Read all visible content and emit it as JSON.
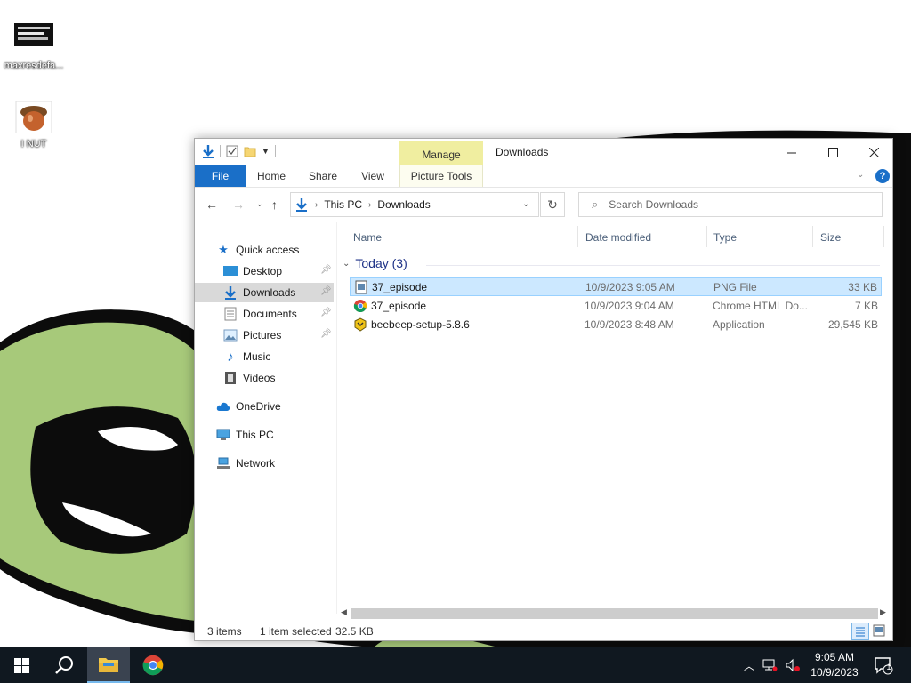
{
  "desktop": {
    "icons": [
      {
        "label": "maxresdefa..."
      },
      {
        "label": "I NUT"
      }
    ]
  },
  "window": {
    "title": "Downloads",
    "contextual_tab": "Manage",
    "ribbon_tabs": {
      "file": "File",
      "home": "Home",
      "share": "Share",
      "view": "View",
      "picture_tools": "Picture Tools"
    },
    "help": "?"
  },
  "navigation": {
    "address": [
      "This PC",
      "Downloads"
    ],
    "search_placeholder": "Search Downloads"
  },
  "nav_pane": {
    "quick_access": "Quick access",
    "items": [
      {
        "label": "Desktop",
        "pinned": true
      },
      {
        "label": "Downloads",
        "pinned": true,
        "selected": true
      },
      {
        "label": "Documents",
        "pinned": true
      },
      {
        "label": "Pictures",
        "pinned": true
      },
      {
        "label": "Music",
        "pinned": false
      },
      {
        "label": "Videos",
        "pinned": false
      }
    ],
    "onedrive": "OneDrive",
    "this_pc": "This PC",
    "network": "Network"
  },
  "file_list": {
    "columns": {
      "name": "Name",
      "date": "Date modified",
      "type": "Type",
      "size": "Size"
    },
    "group": "Today (3)",
    "rows": [
      {
        "name": "37_episode",
        "date": "10/9/2023 9:05 AM",
        "type": "PNG File",
        "size": "33 KB",
        "icon": "png-file-icon",
        "selected": true
      },
      {
        "name": "37_episode",
        "date": "10/9/2023 9:04 AM",
        "type": "Chrome HTML Do...",
        "size": "7 KB",
        "icon": "chrome-icon",
        "selected": false
      },
      {
        "name": "beebeep-setup-5.8.6",
        "date": "10/9/2023 8:48 AM",
        "type": "Application",
        "size": "29,545 KB",
        "icon": "installer-icon",
        "selected": false
      }
    ]
  },
  "status": {
    "items": "3 items",
    "selected": "1 item selected",
    "size": "32.5 KB"
  },
  "taskbar": {
    "time": "9:05 AM",
    "date": "10/9/2023",
    "notification_count": "1"
  },
  "colors": {
    "accent": "#1a6fc8",
    "selection": "#cce8ff",
    "manage_tab": "#f0eea0",
    "taskbar": "#101820"
  }
}
